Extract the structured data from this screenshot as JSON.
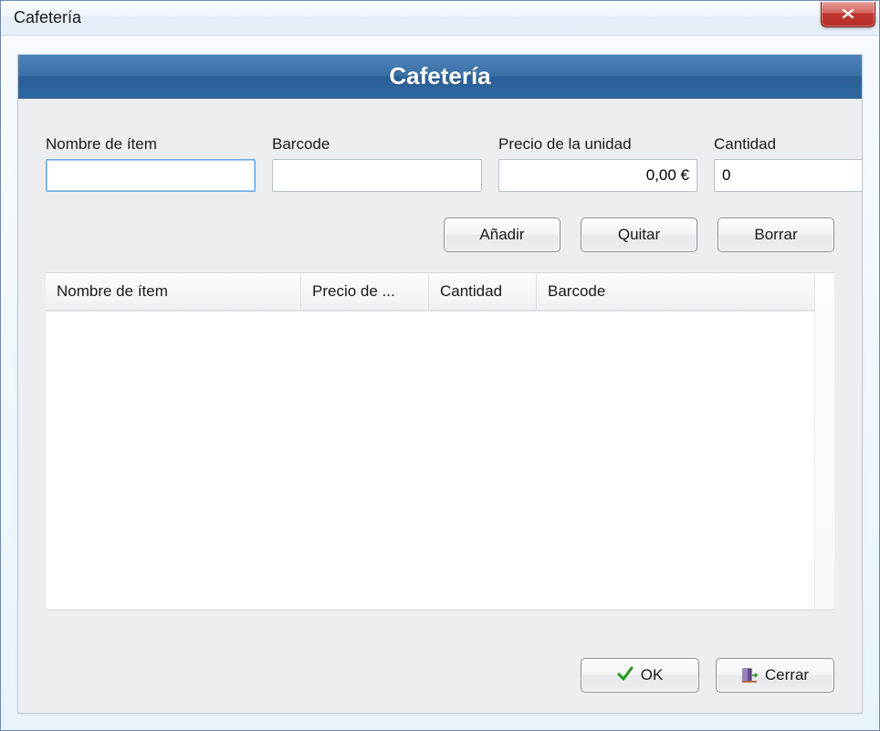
{
  "window": {
    "title": "Cafetería"
  },
  "banner": {
    "title": "Cafetería"
  },
  "fields": {
    "item_name": {
      "label": "Nombre de ítem",
      "value": ""
    },
    "barcode": {
      "label": "Barcode",
      "value": ""
    },
    "unit_price": {
      "label": "Precio de la unidad",
      "value": "0,00 €"
    },
    "quantity": {
      "label": "Cantidad",
      "value": "0"
    }
  },
  "actions": {
    "add": "Añadir",
    "remove": "Quitar",
    "clear": "Borrar"
  },
  "grid": {
    "columns": [
      "Nombre de ítem",
      "Precio de ...",
      "Cantidad",
      "Barcode"
    ]
  },
  "footer": {
    "ok": "OK",
    "close": "Cerrar"
  }
}
